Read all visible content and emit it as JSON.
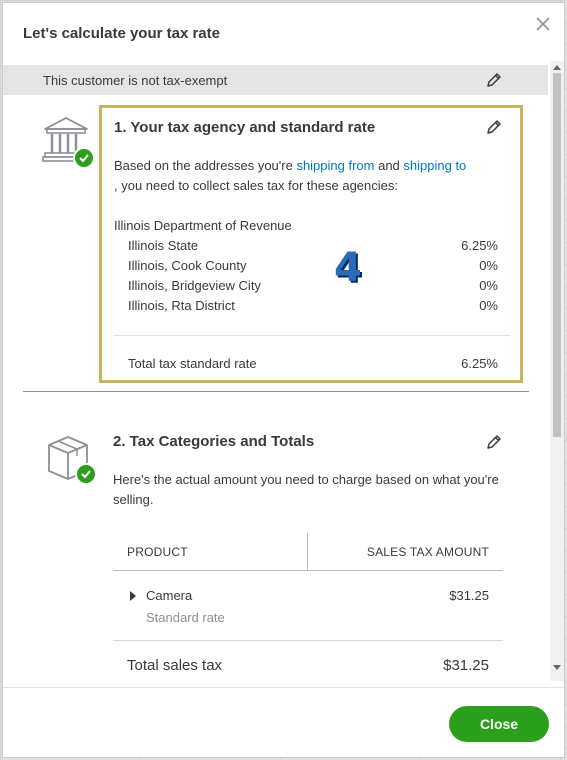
{
  "dialog": {
    "title": "Let's calculate your tax rate",
    "close_icon": "close-icon"
  },
  "exempt": {
    "text": "This customer is not tax-exempt",
    "edit_icon": "pencil-icon"
  },
  "agency_section": {
    "step": "4",
    "title": "1. Your tax agency and standard rate",
    "desc_prefix": "Based on the addresses you're ",
    "link_from": "shipping from",
    "desc_and": " and ",
    "link_to": "shipping to",
    "desc_suffix": ", you need to collect sales tax for these agencies:",
    "agency_name": "Illinois Department of Revenue",
    "rates": [
      {
        "label": "Illinois State",
        "value": "6.25%"
      },
      {
        "label": "Illinois, Cook County",
        "value": "0%"
      },
      {
        "label": "Illinois, Bridgeview City",
        "value": "0%"
      },
      {
        "label": "Illinois, Rta District",
        "value": "0%"
      }
    ],
    "total_label": "Total tax standard rate",
    "total_value": "6.25%"
  },
  "category_section": {
    "title": "2. Tax Categories and Totals",
    "desc": "Here's the actual amount you need to charge based on what you're selling.",
    "table": {
      "col_product": "PRODUCT",
      "col_amount": "SALES TAX AMOUNT",
      "rows": [
        {
          "name": "Camera",
          "sub": "Standard rate",
          "amount": "$31.25"
        }
      ],
      "total_label": "Total sales tax",
      "total_amount": "$31.25"
    }
  },
  "footer": {
    "close_label": "Close"
  },
  "colors": {
    "accent_green": "#2ca01c",
    "link_blue": "#0077c5",
    "highlight_border": "#c8b560",
    "step_number": "#2a6bb8"
  }
}
